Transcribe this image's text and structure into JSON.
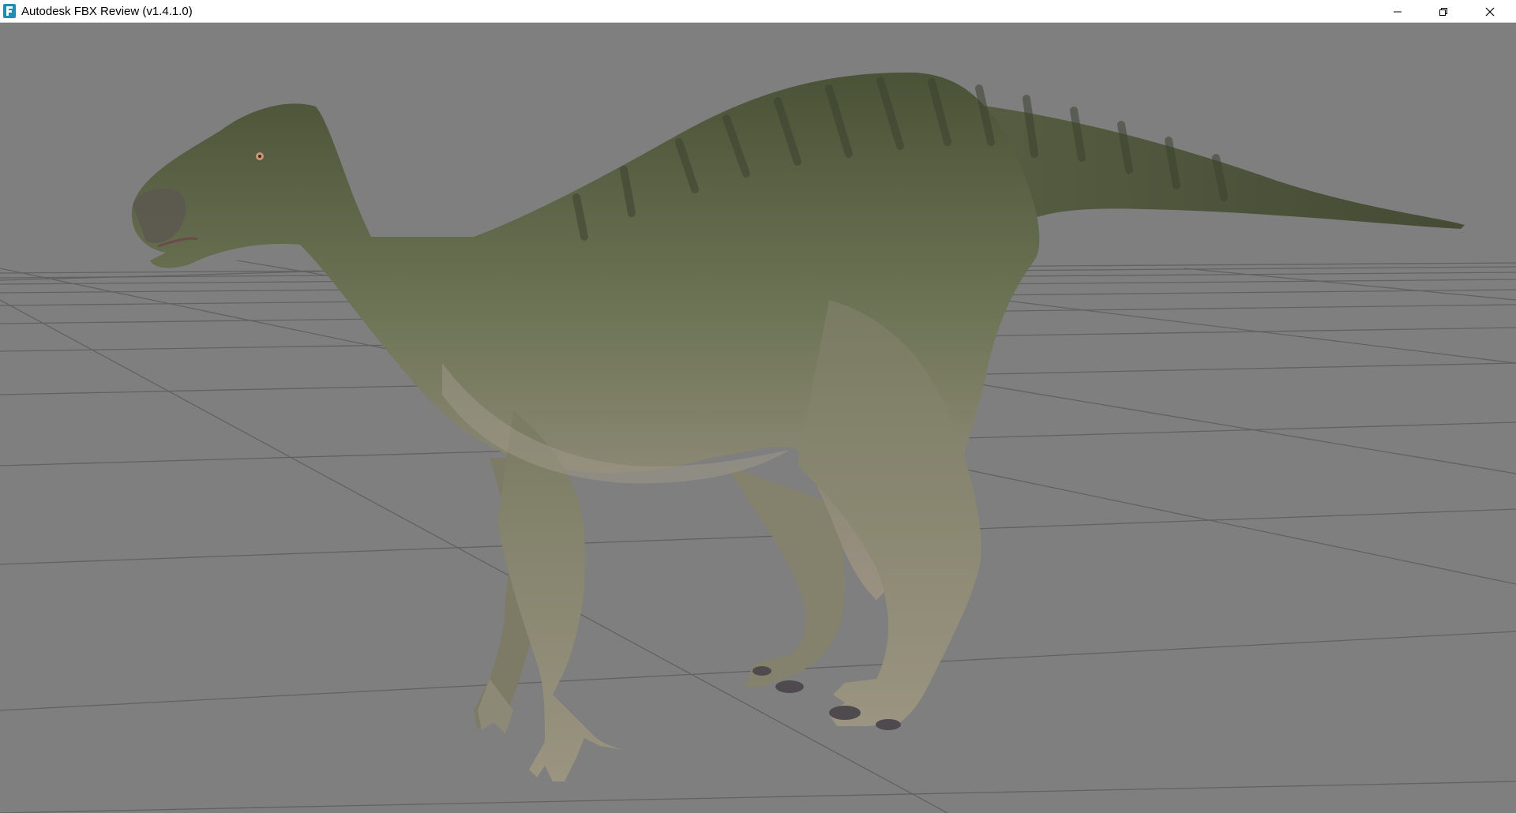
{
  "window": {
    "title": "Autodesk FBX Review (v1.4.1.0)",
    "icon": "fbx-review-app-icon",
    "controls": [
      "minimize-icon",
      "restore-icon",
      "close-icon"
    ]
  },
  "viewport": {
    "background_color": "#7f7f7f",
    "grid_color": "#5c5c5c",
    "model": "dinosaur-model"
  }
}
